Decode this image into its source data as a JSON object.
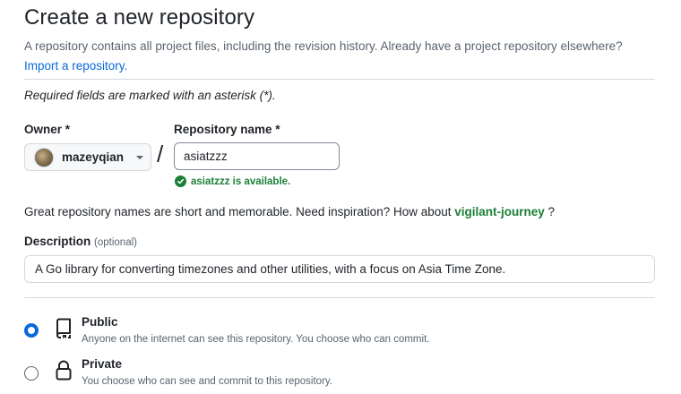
{
  "header": {
    "title": "Create a new repository",
    "subtitle_text": "A repository contains all project files, including the revision history. Already have a project repository elsewhere?",
    "import_link": "Import a repository."
  },
  "form": {
    "required_note": "Required fields are marked with an asterisk (*).",
    "owner_label": "Owner *",
    "owner_value": "mazeyqian",
    "repo_label": "Repository name *",
    "separator": "/",
    "repo_value": "asiatzzz",
    "availability": "asiatzzz is available.",
    "inspiration_text": "Great repository names are short and memorable. Need inspiration? How about",
    "inspiration_suggestion": "vigilant-journey",
    "inspiration_end": "?",
    "description_label": "Description",
    "description_optional": "(optional)",
    "description_value": "A Go library for converting timezones and other utilities, with a focus on Asia Time Zone."
  },
  "visibility": {
    "options": [
      {
        "title": "Public",
        "description": "Anyone on the internet can see this repository. You choose who can commit.",
        "selected": true,
        "icon": "repo-icon"
      },
      {
        "title": "Private",
        "description": "You choose who can see and commit to this repository.",
        "selected": false,
        "icon": "lock-icon"
      }
    ]
  },
  "colors": {
    "accent": "#0969da",
    "success": "#1a7f37",
    "muted": "#59636e",
    "border": "#d1d9e0"
  }
}
